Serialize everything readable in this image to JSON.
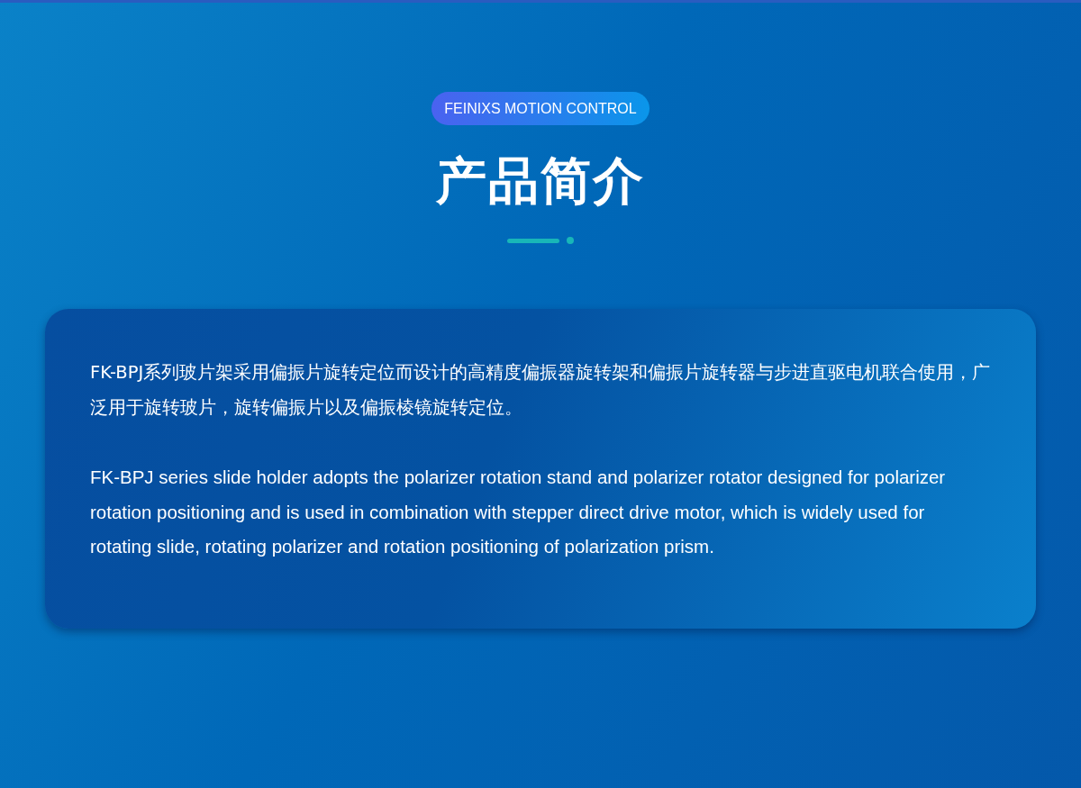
{
  "badge": "FEINIXS MOTION CONTROL",
  "title": "产品简介",
  "card": {
    "paragraphs": [
      "FK-BPJ系列玻片架采用偏振片旋转定位而设计的高精度偏振器旋转架和偏振片旋转器与步进直驱电机联合使用，广泛用于旋转玻片，旋转偏振片以及偏振棱镜旋转定位。",
      "FK-BPJ series slide holder adopts the polarizer rotation stand and polarizer rotator designed for polarizer rotation positioning and is used in combination with stepper direct drive motor, which is widely used for rotating slide, rotating polarizer and rotation positioning of polarization prism."
    ]
  }
}
